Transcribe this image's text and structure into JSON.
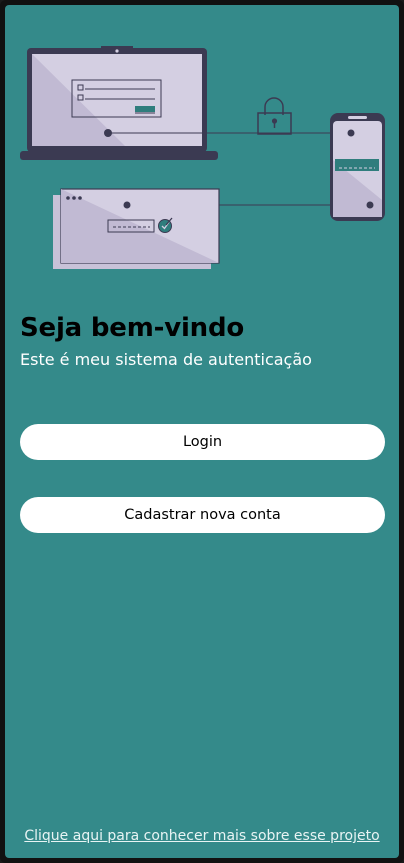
{
  "welcome": {
    "title": "Seja bem-vindo",
    "subtitle": "Este é meu sistema de autenticação"
  },
  "actions": {
    "login_label": "Login",
    "register_label": "Cadastrar nova conta"
  },
  "footer": {
    "link_text": "Clique aqui para conhecer mais sobre esse projeto"
  },
  "colors": {
    "background": "#348a8a",
    "button": "#ffffff",
    "illustration_dark": "#3b3a52",
    "illustration_light": "#d4cfe2",
    "accent": "#2f7d7d"
  }
}
